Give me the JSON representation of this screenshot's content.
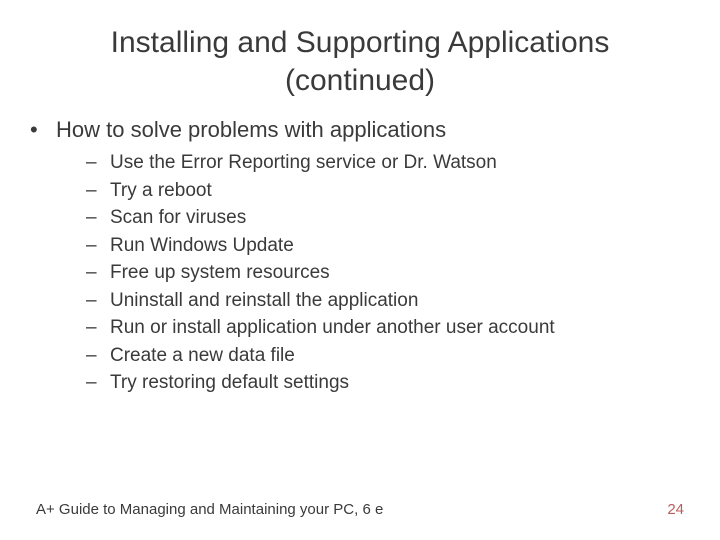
{
  "title_line1": "Installing and Supporting Applications",
  "title_line2": "(continued)",
  "heading": "How to solve problems with applications",
  "items": [
    "Use the Error Reporting service or Dr. Watson",
    "Try a reboot",
    "Scan for viruses",
    "Run Windows Update",
    "Free up system resources",
    "Uninstall and reinstall the application",
    "Run or install application under another user account",
    "Create a new data file",
    "Try restoring default settings"
  ],
  "footer_text": "A+ Guide to Managing and Maintaining your PC, 6 e",
  "page_number": "24"
}
